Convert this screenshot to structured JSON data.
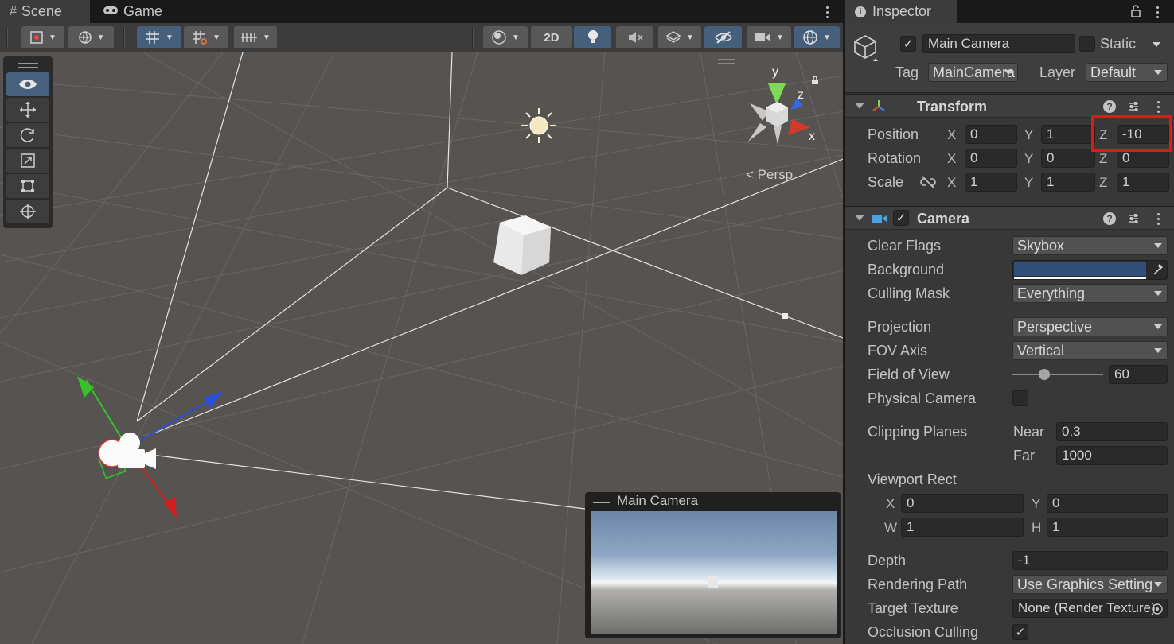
{
  "scene_tabs": [
    {
      "label": "Scene",
      "icon": "hash-icon"
    },
    {
      "label": "Game",
      "icon": "gamepad-icon"
    }
  ],
  "toolbar": {
    "mode_2d": "2D"
  },
  "viewport": {
    "persp_label": "Persp",
    "gizmo_axes": [
      "y",
      "z",
      "x"
    ]
  },
  "camera_preview": {
    "title": "Main Camera"
  },
  "inspector": {
    "tab_label": "Inspector",
    "object": {
      "name": "Main Camera",
      "active": true,
      "static_label": "Static",
      "tag_label": "Tag",
      "tag_value": "MainCamera",
      "layer_label": "Layer",
      "layer_value": "Default"
    },
    "transform": {
      "title": "Transform",
      "position": {
        "label": "Position",
        "x": "0",
        "y": "1",
        "z": "-10"
      },
      "rotation": {
        "label": "Rotation",
        "x": "0",
        "y": "0",
        "z": "0"
      },
      "scale": {
        "label": "Scale",
        "x": "1",
        "y": "1",
        "z": "1"
      },
      "axis_labels": {
        "x": "X",
        "y": "Y",
        "z": "Z"
      }
    },
    "camera": {
      "title": "Camera",
      "enabled": true,
      "clear_flags": {
        "label": "Clear Flags",
        "value": "Skybox"
      },
      "background": {
        "label": "Background",
        "color": "#314d79"
      },
      "culling_mask": {
        "label": "Culling Mask",
        "value": "Everything"
      },
      "projection": {
        "label": "Projection",
        "value": "Perspective"
      },
      "fov_axis": {
        "label": "FOV Axis",
        "value": "Vertical"
      },
      "field_of_view": {
        "label": "Field of View",
        "value": "60"
      },
      "physical_camera": {
        "label": "Physical Camera",
        "checked": false
      },
      "clipping_planes": {
        "label": "Clipping Planes",
        "near_label": "Near",
        "near": "0.3",
        "far_label": "Far",
        "far": "1000"
      },
      "viewport_rect": {
        "label": "Viewport Rect",
        "x_label": "X",
        "x": "0",
        "y_label": "Y",
        "y": "0",
        "w_label": "W",
        "w": "1",
        "h_label": "H",
        "h": "1"
      },
      "depth": {
        "label": "Depth",
        "value": "-1"
      },
      "rendering_path": {
        "label": "Rendering Path",
        "value": "Use Graphics Setting"
      },
      "target_texture": {
        "label": "Target Texture",
        "value": "None (Render Texture)"
      },
      "occlusion_culling": {
        "label": "Occlusion Culling",
        "checked": true
      }
    }
  },
  "colors": {
    "accent_highlight": "#e01818",
    "selected_tool": "#47617f"
  }
}
